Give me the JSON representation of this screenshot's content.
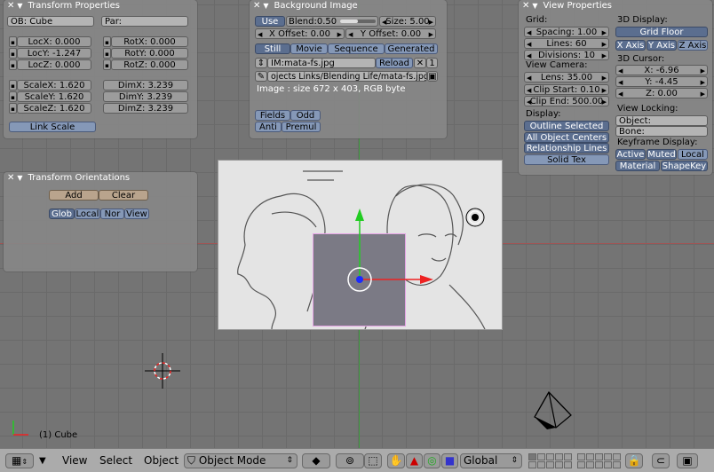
{
  "transform": {
    "title": "Transform Properties",
    "ob": "OB: Cube",
    "par": "Par:",
    "locx": "LocX: 0.000",
    "locy": "LocY: -1.247",
    "locz": "LocZ: 0.000",
    "rotx": "RotX: 0.000",
    "roty": "RotY: 0.000",
    "rotz": "RotZ: 0.000",
    "scalex": "ScaleX: 1.620",
    "scaley": "ScaleY: 1.620",
    "scalez": "ScaleZ: 1.620",
    "dimx": "DimX: 3.239",
    "dimy": "DimY: 3.239",
    "dimz": "DimZ: 3.239",
    "link_scale": "Link Scale"
  },
  "orient": {
    "title": "Transform Orientations",
    "add": "Add",
    "clear": "Clear",
    "glob": "Glob",
    "local": "Local",
    "nor": "Nor",
    "view": "View"
  },
  "bgimage": {
    "title": "Background Image",
    "use": "Use",
    "blend": "Blend:0.50",
    "blend_level": 0.5,
    "size": "Size: 5.00",
    "xoff": "X Offset: 0.00",
    "yoff": "Y Offset: 0.00",
    "still": "Still",
    "movie": "Movie",
    "sequence": "Sequence",
    "generated": "Generated",
    "im": "IM:mata-fs.jpg",
    "reload": "Reload",
    "x_btn": "✕",
    "users": "1",
    "path": "ojects Links/Blending Life/mata-fs.jpg",
    "info": "Image : size 672 x 403, RGB byte",
    "fields": "Fields",
    "odd": "Odd",
    "anti": "Anti",
    "premul": "Premul"
  },
  "view": {
    "title": "View Properties",
    "grid": "Grid:",
    "spacing": "Spacing: 1.00",
    "lines": "Lines: 60",
    "divisions": "Divisions: 10",
    "camera": "View Camera:",
    "lens": "Lens: 35.00",
    "clipstart": "Clip Start: 0.10",
    "clipend": "Clip End: 500.00",
    "display3d": "3D Display:",
    "gridfloor": "Grid Floor",
    "xaxis": "X Axis",
    "yaxis": "Y Axis",
    "zaxis": "Z Axis",
    "cursor": "3D Cursor:",
    "cx": "X: -6.96",
    "cy": "Y: -4.45",
    "cz": "Z: 0.00",
    "locking": "View Locking:",
    "object": "Object:",
    "bone": "Bone:",
    "display": "Display:",
    "outline": "Outline Selected",
    "centers": "All Object Centers",
    "rellines": "Relationship Lines",
    "solidtex": "Solid Tex",
    "keyframe": "Keyframe Display:",
    "active": "Active",
    "muted": "Muted",
    "klocal": "Local",
    "material": "Material",
    "shapekey": "ShapeKey"
  },
  "viewport": {
    "object_label": "(1) Cube"
  },
  "header": {
    "view": "View",
    "select": "Select",
    "object": "Object",
    "mode": "Object Mode",
    "orientation": "Global"
  },
  "colors": {
    "panel": "#878787",
    "blue_button": "#8598b7",
    "selected": "#5b6e8f",
    "x_axis": "#a05555",
    "y_axis": "#3e9a3e",
    "cube": "#7b7a85"
  }
}
